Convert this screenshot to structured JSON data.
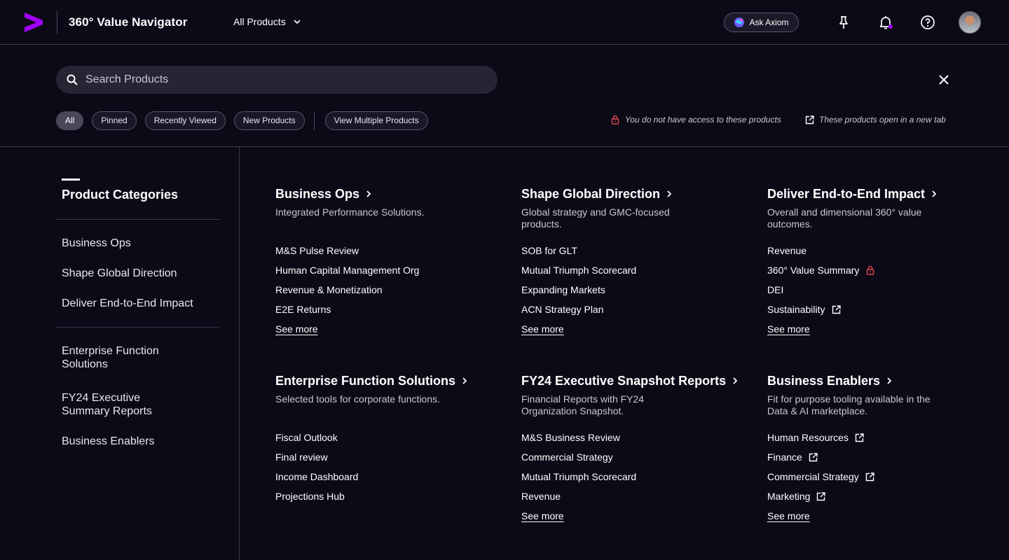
{
  "header": {
    "app_title": "360° Value Navigator",
    "product_select": "All Products",
    "ask_axiom": "Ask Axiom",
    "brand_color": "#a100ff",
    "notification_dot_color": "#a100ff"
  },
  "search": {
    "placeholder": "Search Products",
    "value": ""
  },
  "filters": {
    "chips": [
      "All",
      "Pinned",
      "Recently Viewed",
      "New Products"
    ],
    "active": "All",
    "multi": "View Multiple Products"
  },
  "legend": {
    "locked": "You do not have access to these products",
    "external": "These products open in a new tab",
    "lock_color": "#e0474f"
  },
  "sidebar": {
    "title": "Product Categories",
    "groups": [
      [
        "Business Ops",
        "Shape Global Direction",
        "Deliver End-to-End Impact"
      ],
      [
        "Enterprise Function Solutions",
        "FY24 Executive Summary Reports",
        "Business Enablers"
      ]
    ]
  },
  "categories": [
    {
      "title": "Business Ops",
      "description": "Integrated Performance Solutions.",
      "items": [
        {
          "label": "M&S Pulse Review",
          "icon": ""
        },
        {
          "label": "Human Capital Management Org",
          "icon": ""
        },
        {
          "label": "Revenue & Monetization",
          "icon": ""
        },
        {
          "label": "E2E Returns",
          "icon": ""
        }
      ],
      "see_more": "See more"
    },
    {
      "title": "Shape Global Direction",
      "description": "Global strategy and GMC-focused products.",
      "items": [
        {
          "label": "SOB for GLT",
          "icon": ""
        },
        {
          "label": "Mutual Triumph Scorecard",
          "icon": ""
        },
        {
          "label": "Expanding Markets",
          "icon": ""
        },
        {
          "label": "ACN Strategy Plan",
          "icon": ""
        }
      ],
      "see_more": "See more"
    },
    {
      "title": "Deliver End-to-End Impact",
      "description": "Overall and dimensional 360° value outcomes.",
      "items": [
        {
          "label": "Revenue",
          "icon": ""
        },
        {
          "label": "360° Value Summary",
          "icon": "lock"
        },
        {
          "label": "DEI",
          "icon": ""
        },
        {
          "label": "Sustainability",
          "icon": "external"
        }
      ],
      "see_more": "See more"
    },
    {
      "title": "Enterprise Function Solutions",
      "description": "Selected tools for corporate functions.",
      "items": [
        {
          "label": "Fiscal Outlook",
          "icon": ""
        },
        {
          "label": "Final review",
          "icon": ""
        },
        {
          "label": "Income Dashboard",
          "icon": ""
        },
        {
          "label": "Projections Hub",
          "icon": ""
        }
      ],
      "see_more": ""
    },
    {
      "title": "FY24 Executive Snapshot Reports",
      "description": "Financial Reports with FY24 Organization Snapshot.",
      "items": [
        {
          "label": "M&S Business Review",
          "icon": ""
        },
        {
          "label": "Commercial Strategy",
          "icon": ""
        },
        {
          "label": "Mutual Triumph Scorecard",
          "icon": ""
        },
        {
          "label": "Revenue",
          "icon": ""
        }
      ],
      "see_more": "See more"
    },
    {
      "title": "Business Enablers",
      "description": "Fit for purpose tooling available in the Data & AI marketplace.",
      "items": [
        {
          "label": "Human Resources",
          "icon": "external"
        },
        {
          "label": "Finance",
          "icon": "external"
        },
        {
          "label": "Commercial Strategy",
          "icon": "external"
        },
        {
          "label": "Marketing",
          "icon": "external"
        }
      ],
      "see_more": "See more"
    }
  ]
}
